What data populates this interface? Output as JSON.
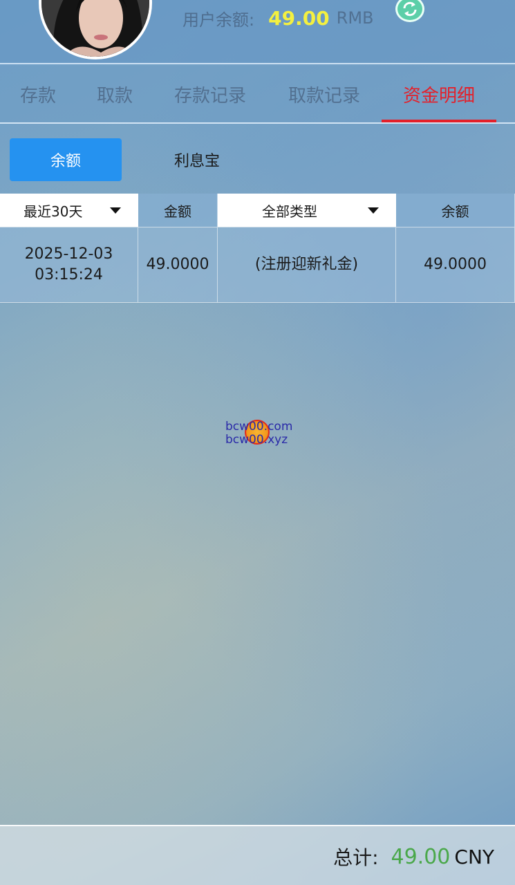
{
  "header": {
    "balance_label": "用户余额:",
    "balance_value": "49.00",
    "balance_unit": "RMB"
  },
  "tabs": [
    {
      "label": "存款"
    },
    {
      "label": "取款"
    },
    {
      "label": "存款记录"
    },
    {
      "label": "取款记录"
    },
    {
      "label": "资金明细",
      "active": true
    }
  ],
  "subtabs": [
    {
      "label": "余额",
      "active": true
    },
    {
      "label": "利息宝"
    }
  ],
  "table": {
    "headers": {
      "period_select": "最近30天",
      "amount": "金额",
      "type_select": "全部类型",
      "balance": "余额"
    },
    "rows": [
      {
        "date": "2025-12-03",
        "time": "03:15:24",
        "amount": "49.0000",
        "type": "(注册迎新礼金)",
        "balance": "49.0000"
      }
    ]
  },
  "watermark": {
    "line1": "bcw00.com",
    "line2": "bcw00.xyz"
  },
  "footer": {
    "total_label": "总计:",
    "total_value": "49.00",
    "total_unit": "CNY"
  },
  "colors": {
    "active_tab": "#e4202a",
    "active_subtab": "#2592f0",
    "balance_value": "#f4f040",
    "total_value": "#4aa84a",
    "refresh_icon": "#5ccfa8"
  }
}
